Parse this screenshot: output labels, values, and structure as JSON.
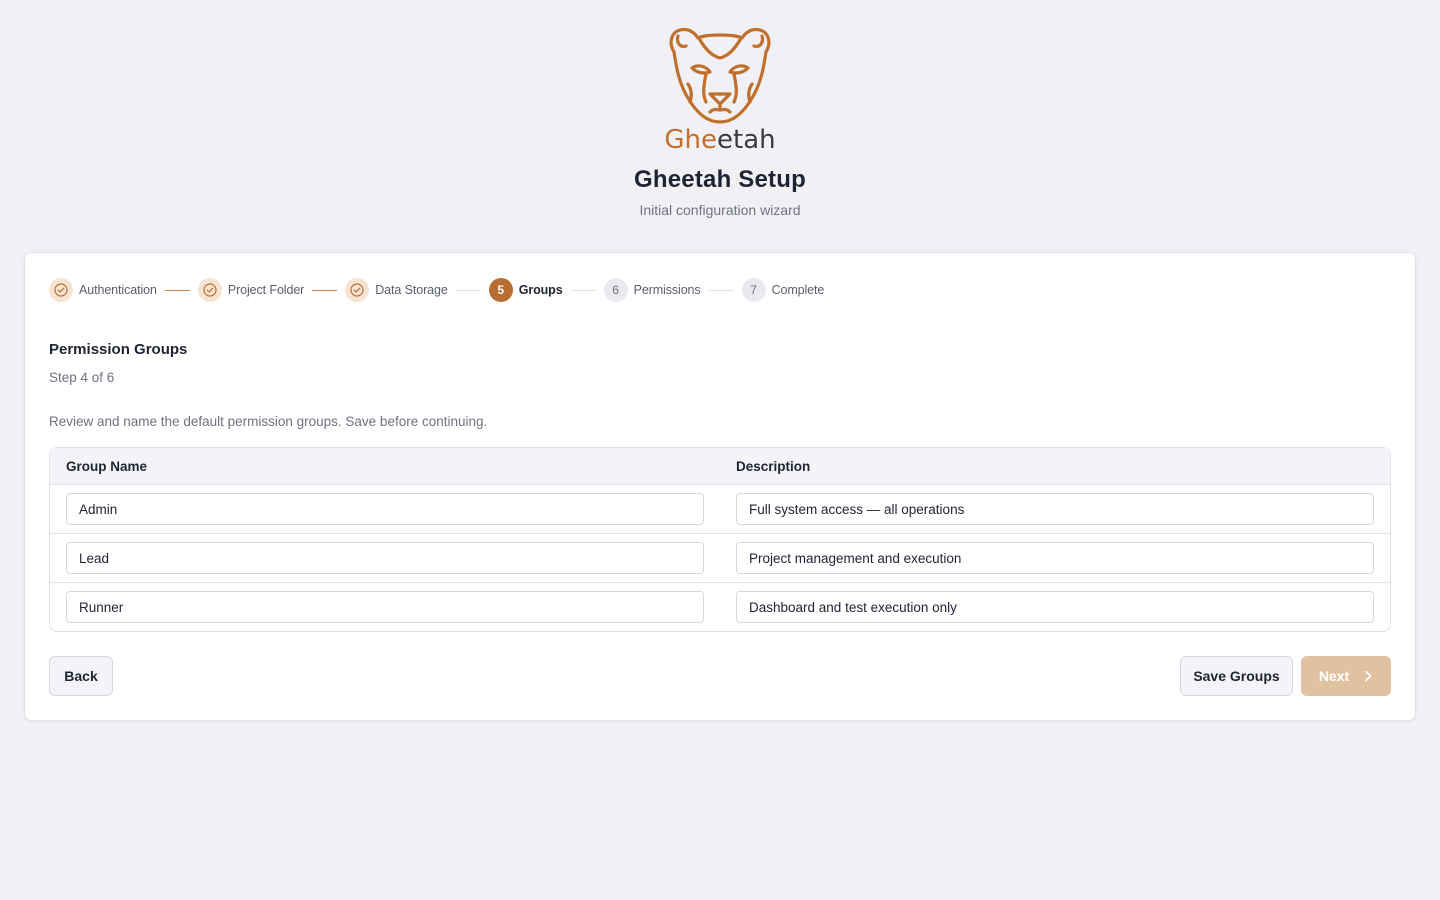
{
  "brand": {
    "logo_word_accent": "Ghe",
    "logo_word_rest": "etah",
    "accent_color": "#b86e32"
  },
  "header": {
    "title": "Gheetah Setup",
    "subtitle": "Initial configuration wizard"
  },
  "stepper": {
    "steps": [
      {
        "label": "Authentication",
        "state": "done",
        "icon": "check-circle-icon"
      },
      {
        "label": "Project Folder",
        "state": "done",
        "icon": "check-circle-icon"
      },
      {
        "label": "Data Storage",
        "state": "done",
        "icon": "check-circle-icon"
      },
      {
        "label": "Groups",
        "state": "active",
        "number": "5"
      },
      {
        "label": "Permissions",
        "state": "todo",
        "number": "6"
      },
      {
        "label": "Complete",
        "state": "todo",
        "number": "7"
      }
    ]
  },
  "section": {
    "title": "Permission Groups",
    "step_text": "Step 4 of 6",
    "description": "Review and name the default permission groups. Save before continuing."
  },
  "table": {
    "headers": [
      "Group Name",
      "Description"
    ],
    "rows": [
      {
        "name": "Admin",
        "description": "Full system access — all operations"
      },
      {
        "name": "Lead",
        "description": "Project management and execution"
      },
      {
        "name": "Runner",
        "description": "Dashboard and test execution only"
      }
    ]
  },
  "actions": {
    "back_label": "Back",
    "save_label": "Save Groups",
    "next_label": "Next",
    "next_icon": "chevron-right-icon"
  }
}
